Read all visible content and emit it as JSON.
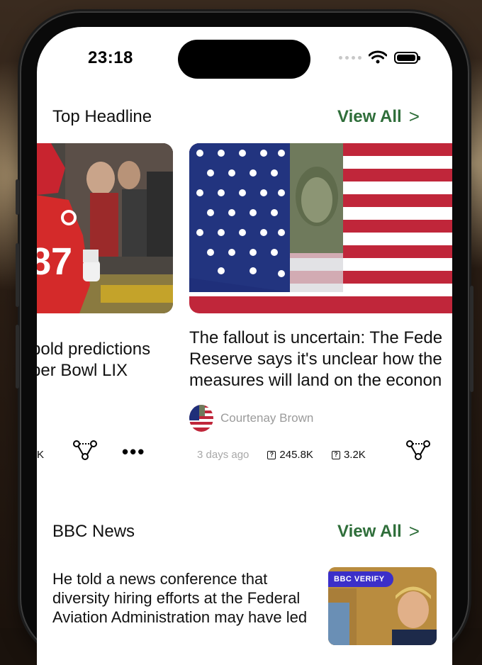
{
  "status_bar": {
    "time": "23:18"
  },
  "top_headline": {
    "title": "Top Headline",
    "view_all": "View All",
    "chevron": ">"
  },
  "cards": [
    {
      "headline_lines": [
        "bold predictions",
        "per Bowl LIX"
      ],
      "stat_fragment": "K"
    },
    {
      "headline_lines": [
        "The fallout is uncertain: The Fede",
        "Reserve says it's unclear how the",
        "measures will land on the econon"
      ],
      "author": "Courtenay Brown",
      "time_ago": "3 days ago",
      "views": "245.8K",
      "comments": "3.2K"
    }
  ],
  "bbc_news": {
    "title": "BBC News",
    "view_all": "View All",
    "chevron": ">",
    "article": {
      "headline_lines": [
        "He told a news conference that",
        "diversity hiring efforts at the Federal",
        "Aviation Administration may have led"
      ],
      "badge": "BBC VERIFY"
    }
  },
  "icons": {
    "share": "share-nodes-icon",
    "more": "more-dots-icon",
    "views": "views-icon",
    "comments": "comments-icon",
    "wifi": "wifi-icon",
    "battery": "battery-icon",
    "signal": "signal-dots-icon"
  },
  "colors": {
    "accent": "#2f6e3a",
    "muted": "#9b9b9b"
  }
}
